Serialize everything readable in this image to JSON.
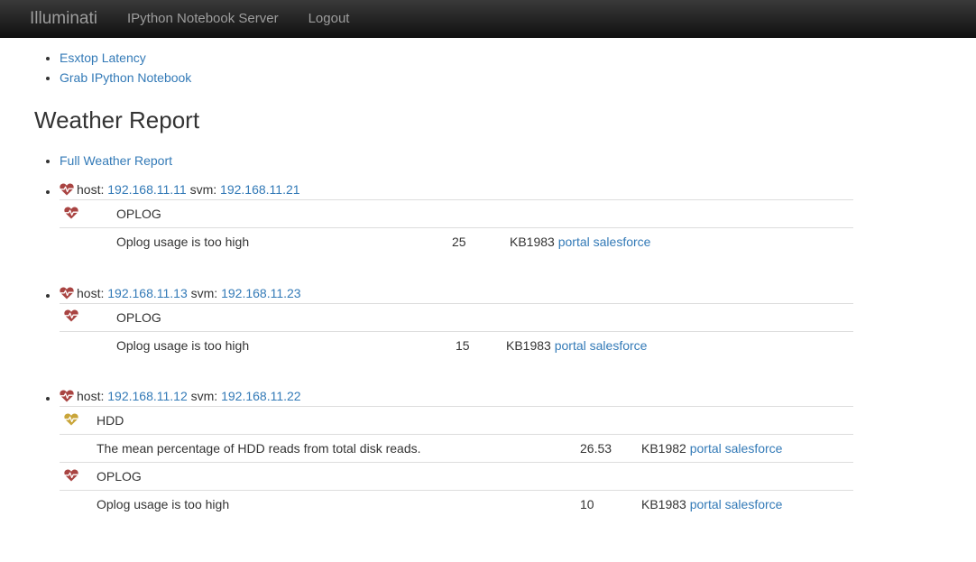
{
  "navbar": {
    "brand": "Illuminati",
    "links": [
      "IPython Notebook Server",
      "Logout"
    ]
  },
  "top_links": [
    "Esxtop Latency",
    "Grab IPython Notebook"
  ],
  "title": "Weather Report",
  "full_report_link": "Full Weather Report",
  "labels": {
    "host": "host:",
    "svm": "svm:",
    "portal": "portal",
    "salesforce": "salesforce"
  },
  "colors": {
    "critical": "#a94442",
    "warning": "#c9a53a",
    "link": "#337ab7"
  },
  "hosts": [
    {
      "host_ip": "192.168.11.11",
      "svm_ip": "192.168.11.21",
      "checks": [
        {
          "category": "OPLOG",
          "severity": "critical",
          "message": "Oplog usage is too high",
          "value": "25",
          "kb": "KB1983"
        }
      ]
    },
    {
      "host_ip": "192.168.11.13",
      "svm_ip": "192.168.11.23",
      "checks": [
        {
          "category": "OPLOG",
          "severity": "critical",
          "message": "Oplog usage is too high",
          "value": "15",
          "kb": "KB1983"
        }
      ]
    },
    {
      "host_ip": "192.168.11.12",
      "svm_ip": "192.168.11.22",
      "checks": [
        {
          "category": "HDD",
          "severity": "warning",
          "message": "The mean percentage of HDD reads from total disk reads.",
          "value": "26.53",
          "kb": "KB1982"
        },
        {
          "category": "OPLOG",
          "severity": "critical",
          "message": "Oplog usage is too high",
          "value": "10",
          "kb": "KB1983"
        }
      ]
    }
  ]
}
